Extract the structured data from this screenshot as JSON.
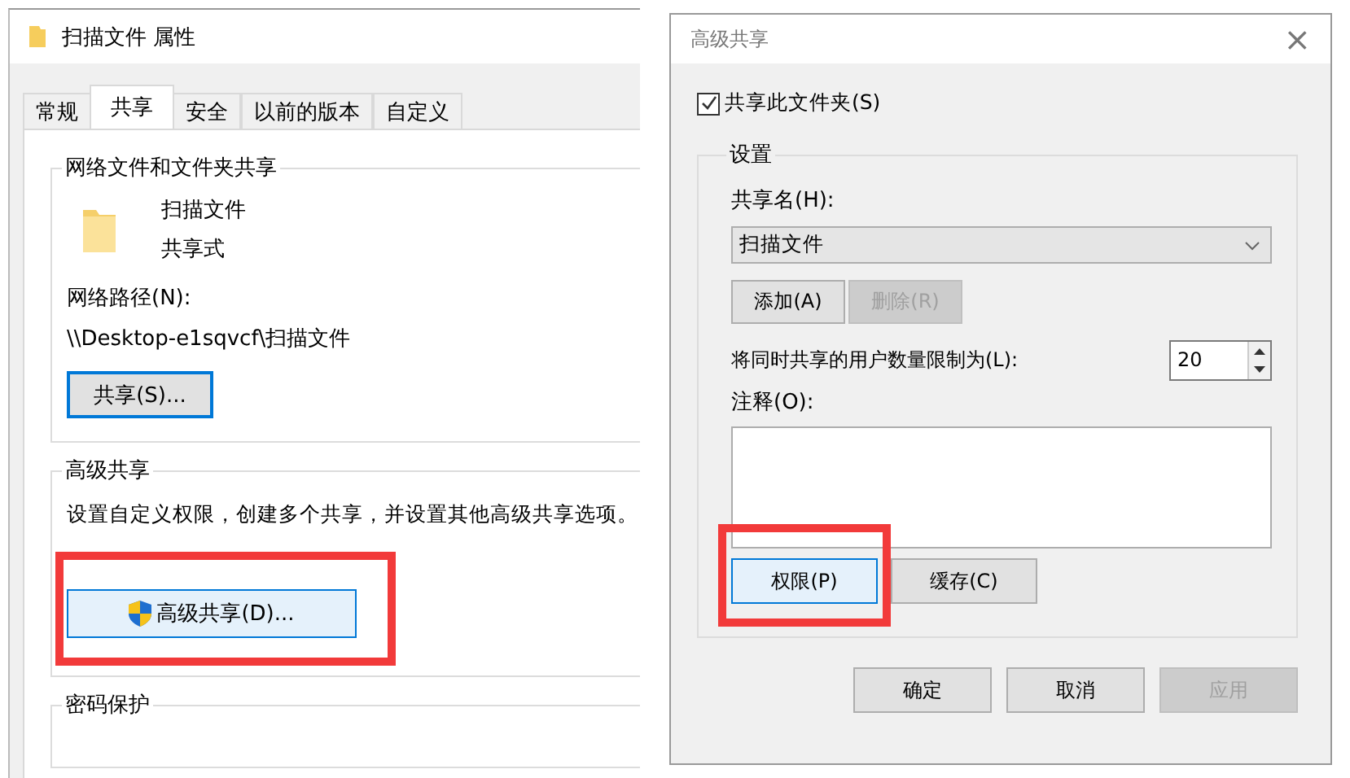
{
  "properties_window": {
    "title": "扫描文件 属性",
    "tabs": [
      {
        "label": "常规",
        "selected": false
      },
      {
        "label": "共享",
        "selected": true
      },
      {
        "label": "安全",
        "selected": false
      },
      {
        "label": "以前的版本",
        "selected": false
      },
      {
        "label": "自定义",
        "selected": false
      }
    ],
    "network_group": {
      "title": "网络文件和文件夹共享",
      "folder_name": "扫描文件",
      "share_status": "共享式",
      "path_label": "网络路径(N):",
      "path": "\\\\Desktop-e1sqvcf\\扫描文件",
      "share_button": "共享(S)..."
    },
    "advanced_group": {
      "title": "高级共享",
      "description": "设置自定义权限，创建多个共享，并设置其他高级共享选项。",
      "button": "高级共享(D)..."
    },
    "password_group": {
      "title": "密码保护"
    }
  },
  "advanced_dialog": {
    "title": "高级共享",
    "close": "×",
    "share_checkbox": {
      "label": "共享此文件夹(S)",
      "checked": true
    },
    "settings_group": {
      "title": "设置",
      "share_name_label": "共享名(H):",
      "share_name": "扫描文件",
      "name_buttons": [
        {
          "label": "添加(A)",
          "disabled": false
        },
        {
          "label": "删除(R)",
          "disabled": true
        }
      ],
      "user_limit_label": "将同时共享的用户数量限制为(L):",
      "user_limit": "20",
      "comment_label": "注释(O):",
      "comment_buttons": [
        {
          "label": "权限(P)",
          "focused": true
        },
        {
          "label": "缓存(C)",
          "focused": false
        }
      ]
    },
    "footer_buttons": [
      {
        "label": "确定",
        "disabled": false
      },
      {
        "label": "取消",
        "disabled": false
      },
      {
        "label": "应用",
        "disabled": true
      }
    ]
  }
}
